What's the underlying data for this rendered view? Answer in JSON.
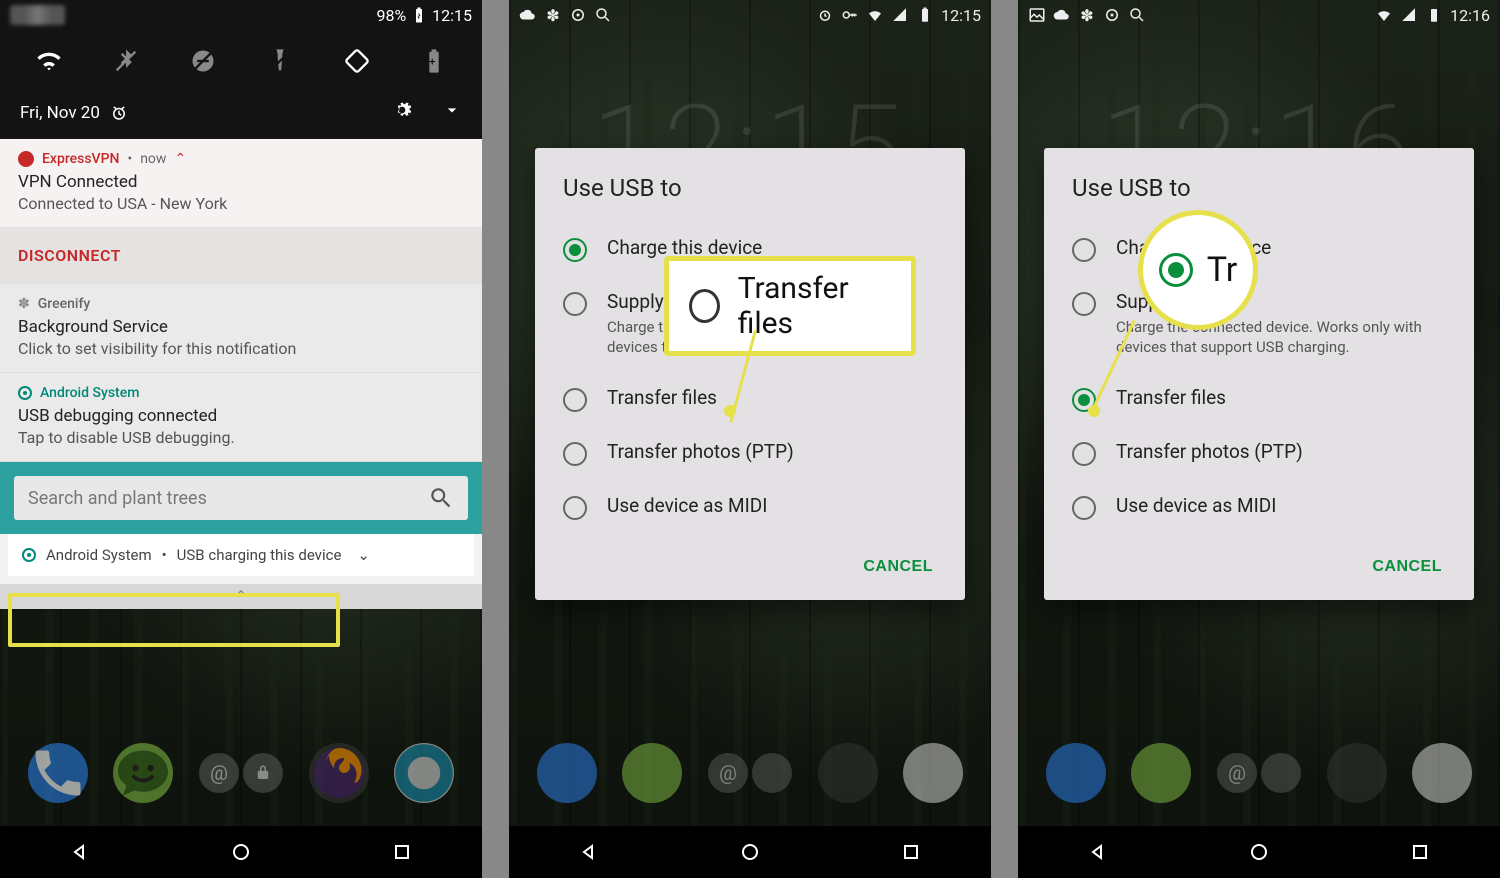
{
  "phone1": {
    "status": {
      "battery": "98%",
      "time": "12:15"
    },
    "date": "Fri, Nov 20",
    "notifications": {
      "vpn": {
        "app": "ExpressVPN",
        "when": "now",
        "title": "VPN Connected",
        "text": "Connected to USA - New York",
        "action": "DISCONNECT"
      },
      "greenify": {
        "app": "Greenify",
        "title": "Background Service",
        "text": "Click to set visibility for this notification"
      },
      "adb": {
        "app": "Android System",
        "title": "USB debugging connected",
        "text": "Tap to disable USB debugging."
      }
    },
    "search_placeholder": "Search and plant trees",
    "collapsed": {
      "app": "Android System",
      "text": "USB charging this device"
    }
  },
  "dialog": {
    "title": "Use USB to",
    "options": {
      "charge": "Charge this device",
      "supply": "Supply power",
      "supply_hint": "Charge the connected device. Works only with devices that support USB charging.",
      "files": "Transfer files",
      "ptp": "Transfer photos (PTP)",
      "midi": "Use device as MIDI"
    },
    "cancel": "CANCEL"
  },
  "phone2": {
    "time": "12:15",
    "clock": "12:15",
    "callout": "Transfer files"
  },
  "phone3": {
    "time": "12:16",
    "clock": "12:16",
    "callout_text": "Tr"
  },
  "colors": {
    "accent": "#0a8f3c",
    "vpn": "#c62828",
    "highlight": "#e6e04a",
    "teal_search": "#2da0a0"
  }
}
